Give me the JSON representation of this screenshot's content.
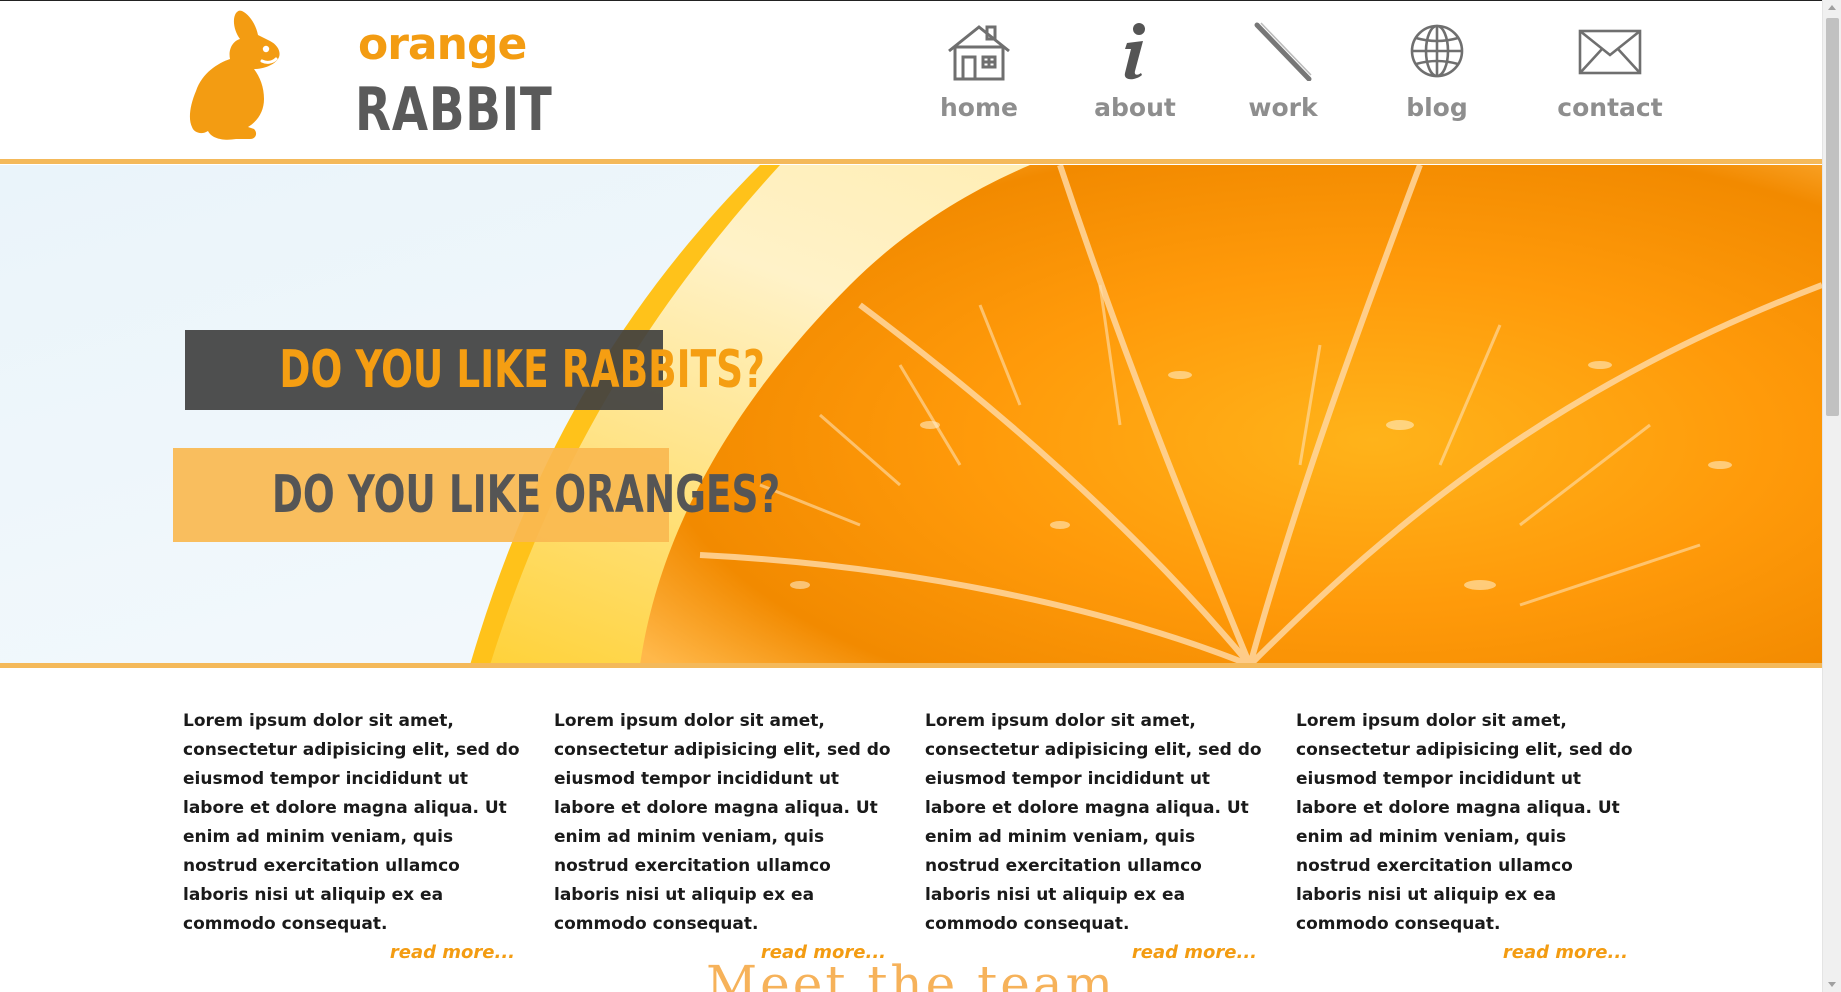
{
  "brand": {
    "line1": "orange",
    "line2": "RABBIT",
    "accent_color": "#f39c12",
    "text_color": "#5a5a5a"
  },
  "nav": {
    "items": [
      {
        "label": "home",
        "icon": "house-icon"
      },
      {
        "label": "about",
        "icon": "info-icon"
      },
      {
        "label": "work",
        "icon": "pencil-icon"
      },
      {
        "label": "blog",
        "icon": "globe-icon"
      },
      {
        "label": "contact",
        "icon": "envelope-icon"
      }
    ]
  },
  "hero": {
    "banner1": "DO YOU LIKE RABBITS?",
    "banner2": "DO YOU LIKE ORANGES?"
  },
  "columns": [
    {
      "text": "Lorem ipsum dolor sit amet, consectetur adipisicing elit, sed do eiusmod tempor incididunt ut labore et dolore magna aliqua. Ut enim ad minim veniam, quis nostrud exercitation ullamco laboris nisi ut aliquip ex ea commodo consequat.",
      "more": "read more..."
    },
    {
      "text": "Lorem ipsum dolor sit amet, consectetur adipisicing elit, sed do eiusmod tempor incididunt ut labore et dolore magna aliqua. Ut enim ad minim veniam, quis nostrud exercitation ullamco laboris nisi ut aliquip ex ea commodo consequat.",
      "more": "read more..."
    },
    {
      "text": "Lorem ipsum dolor sit amet, consectetur adipisicing elit, sed do eiusmod tempor incididunt ut labore et dolore magna aliqua. Ut enim ad minim veniam, quis nostrud exercitation ullamco laboris nisi ut aliquip ex ea commodo consequat.",
      "more": "read more..."
    },
    {
      "text": "Lorem ipsum dolor sit amet, consectetur adipisicing elit, sed do eiusmod tempor incididunt ut labore et dolore magna aliqua. Ut enim ad minim veniam, quis nostrud exercitation ullamco laboris nisi ut aliquip ex ea commodo consequat.",
      "more": "read more..."
    }
  ],
  "team": {
    "title": "Meet the team"
  }
}
